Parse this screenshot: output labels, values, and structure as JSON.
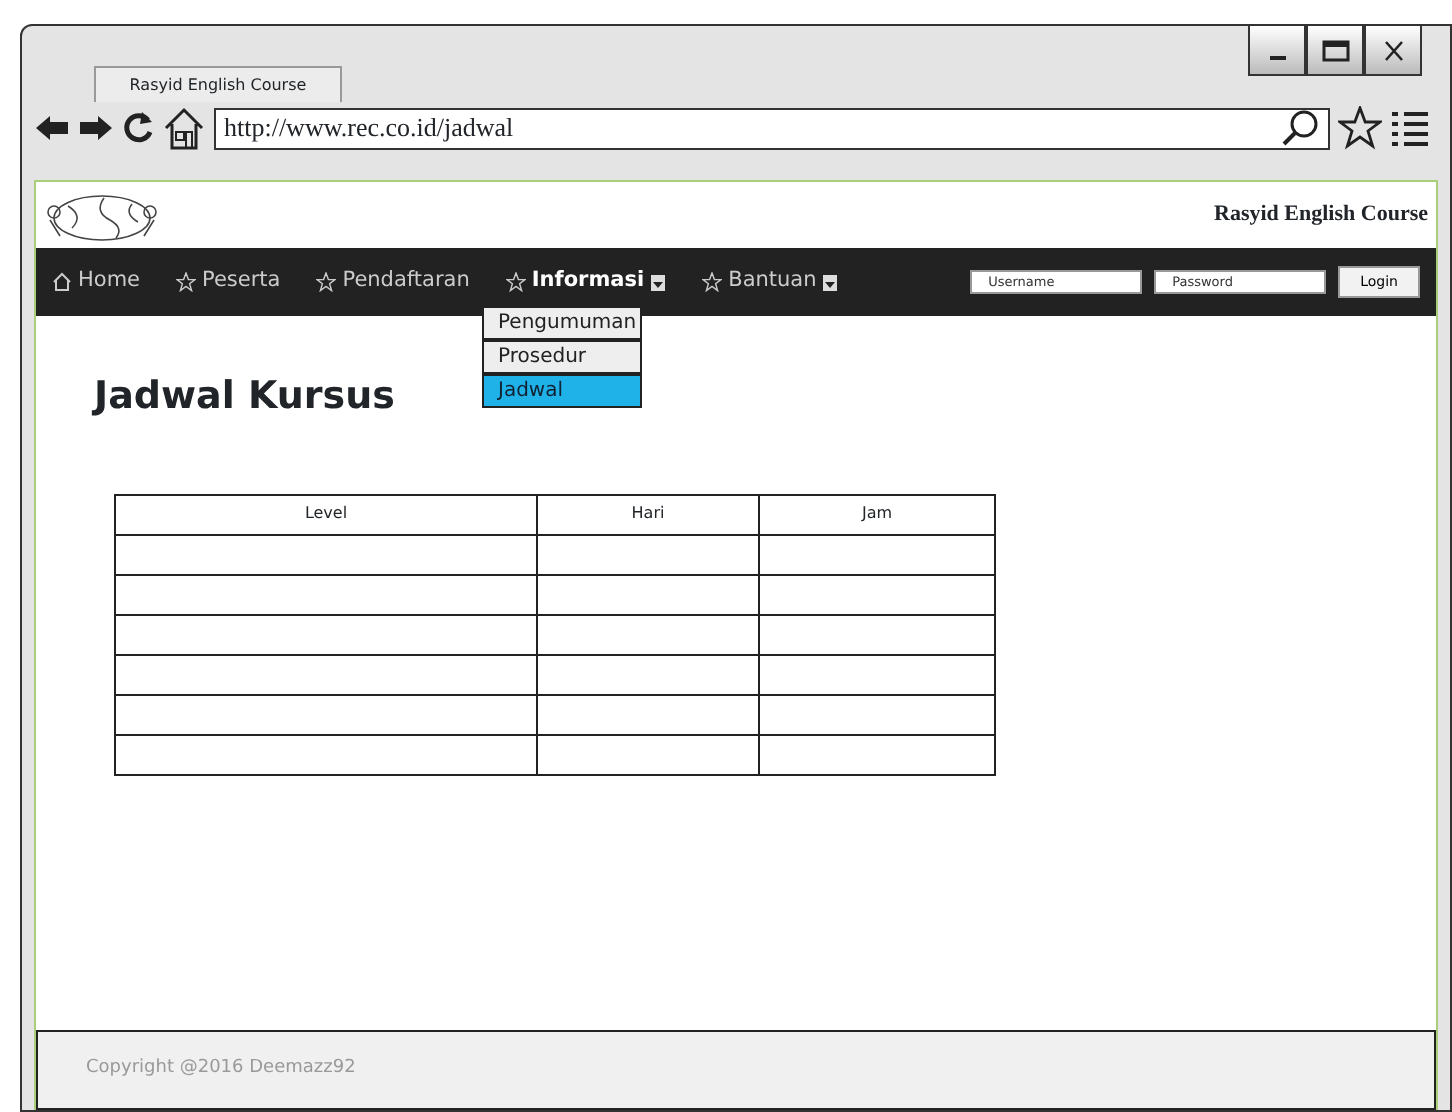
{
  "browser": {
    "tab_title": "Rasyid English Course",
    "url": "http://www.rec.co.id/jadwal"
  },
  "site_title": "Rasyid English Course",
  "nav": [
    {
      "label": "Home",
      "kind": "home",
      "dropdown": false,
      "selected": false
    },
    {
      "label": "Peserta",
      "kind": "star",
      "dropdown": false,
      "selected": false
    },
    {
      "label": "Pendaftaran",
      "kind": "star",
      "dropdown": false,
      "selected": false
    },
    {
      "label": "Informasi",
      "kind": "star",
      "dropdown": true,
      "selected": true
    },
    {
      "label": "Bantuan",
      "kind": "star",
      "dropdown": true,
      "selected": false
    }
  ],
  "dropdown_menu": [
    {
      "label": "Pengumuman",
      "selected": false
    },
    {
      "label": "Prosedur",
      "selected": false
    },
    {
      "label": "Jadwal",
      "selected": true
    }
  ],
  "login": {
    "username_placeholder": "Username",
    "password_placeholder": "Password",
    "button": "Login"
  },
  "heading": "Jadwal Kursus",
  "table": {
    "columns": [
      "Level",
      "Hari",
      "Jam"
    ],
    "rows": [
      {
        "kind": "blank"
      },
      {
        "kind": "blank"
      },
      {
        "kind": "blank"
      },
      {
        "kind": "blank"
      },
      {
        "kind": "blank"
      },
      {
        "kind": "blank"
      }
    ]
  },
  "footer": "Copyright @2016 Deemazz92"
}
